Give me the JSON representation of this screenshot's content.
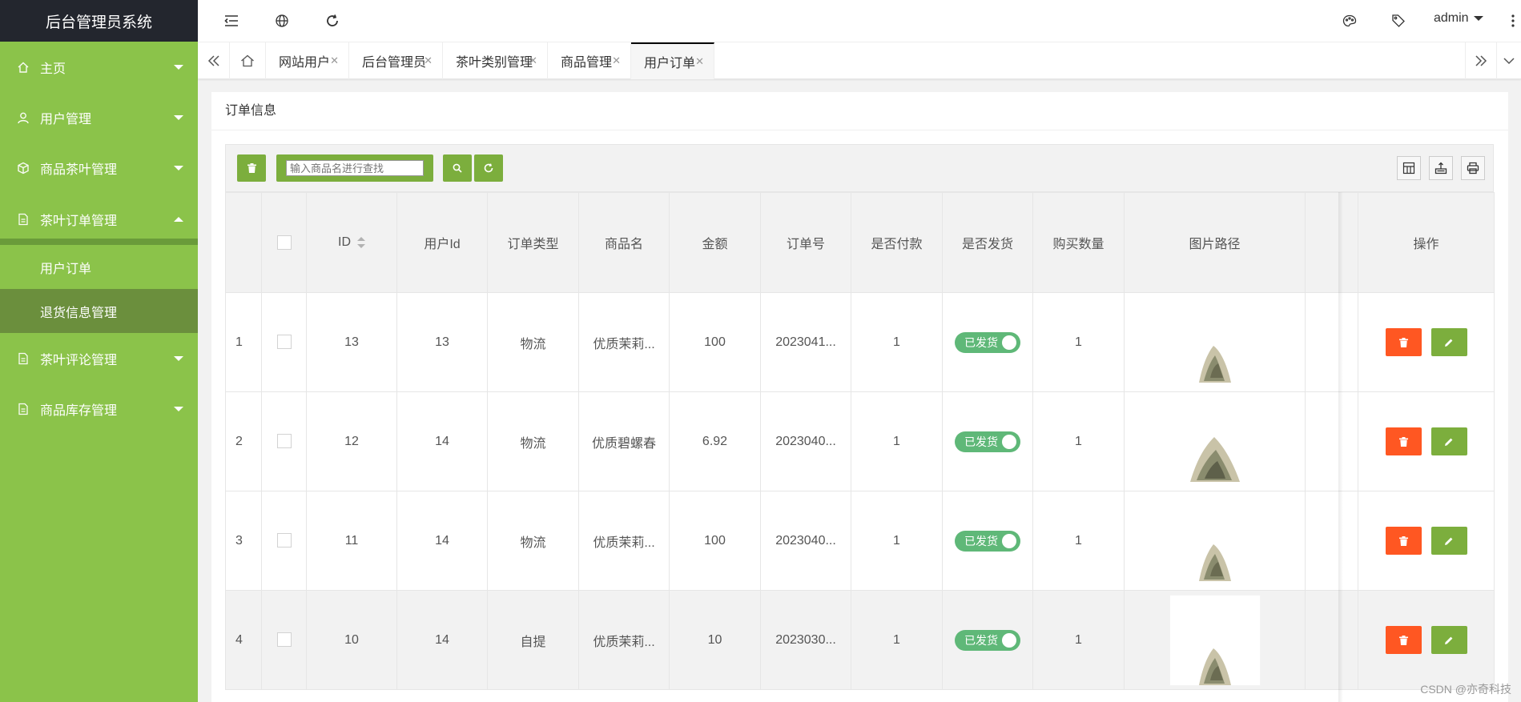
{
  "app": {
    "title": "后台管理员系统"
  },
  "sidebar": {
    "items": [
      {
        "label": "主页",
        "icon": "home-icon"
      },
      {
        "label": "用户管理",
        "icon": "user-icon"
      },
      {
        "label": "商品茶叶管理",
        "icon": "cube-icon"
      },
      {
        "label": "茶叶订单管理",
        "icon": "doc-icon",
        "open": true,
        "children": [
          {
            "label": "用户订单",
            "active": true
          },
          {
            "label": "退货信息管理"
          }
        ]
      },
      {
        "label": "茶叶评论管理",
        "icon": "doc-icon"
      },
      {
        "label": "商品库存管理",
        "icon": "doc-icon"
      }
    ]
  },
  "header": {
    "user": "admin"
  },
  "tabs": [
    {
      "label": "网站用户"
    },
    {
      "label": "后台管理员"
    },
    {
      "label": "茶叶类别管理"
    },
    {
      "label": "商品管理"
    },
    {
      "label": "用户订单",
      "active": true
    }
  ],
  "card": {
    "title": "订单信息"
  },
  "toolbar": {
    "search_placeholder": "输入商品名进行查找"
  },
  "table": {
    "columns": [
      "",
      "",
      "ID",
      "用户Id",
      "订单类型",
      "商品名",
      "金额",
      "订单号",
      "是否付款",
      "是否发货",
      "购买数量",
      "图片路径",
      "",
      "操作"
    ],
    "rows": [
      {
        "idx": "1",
        "id": "13",
        "userId": "13",
        "type": "物流",
        "product": "优质茉莉...",
        "amount": "100",
        "order": "2023041...",
        "paid": "1",
        "shipped": "已发货",
        "qty": "1"
      },
      {
        "idx": "2",
        "id": "12",
        "userId": "14",
        "type": "物流",
        "product": "优质碧螺春",
        "amount": "6.92",
        "order": "2023040...",
        "paid": "1",
        "shipped": "已发货",
        "qty": "1"
      },
      {
        "idx": "3",
        "id": "11",
        "userId": "14",
        "type": "物流",
        "product": "优质茉莉...",
        "amount": "100",
        "order": "2023040...",
        "paid": "1",
        "shipped": "已发货",
        "qty": "1"
      },
      {
        "idx": "4",
        "id": "10",
        "userId": "14",
        "type": "自提",
        "product": "优质茉莉...",
        "amount": "10",
        "order": "2023030...",
        "paid": "1",
        "shipped": "已发货",
        "qty": "1"
      }
    ]
  },
  "watermark": "CSDN @亦奇科技",
  "colors": {
    "sidebar": "#8bc34a",
    "sidebar_dark": "#6b8f3d",
    "logo_bg": "#23262e",
    "btn_green": "#7cae3d",
    "danger": "#ff5722",
    "switch_on": "#5fb878"
  }
}
